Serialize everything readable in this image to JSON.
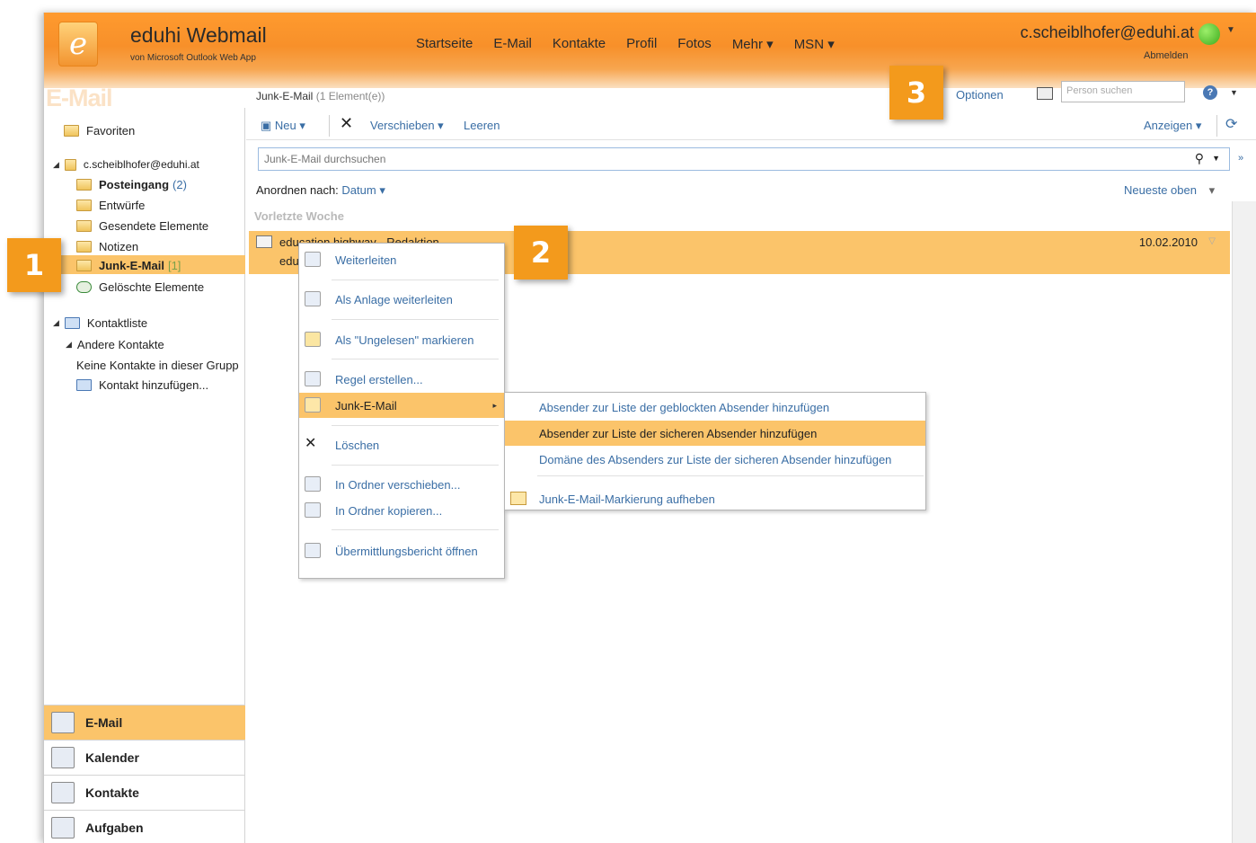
{
  "app": {
    "title": "eduhi Webmail",
    "subtitle": "von Microsoft Outlook Web App",
    "logo_letter": "e",
    "user": "c.scheiblhofer@eduhi.at",
    "signout": "Abmelden"
  },
  "topnav": [
    "Startseite",
    "E-Mail",
    "Kontakte",
    "Profil",
    "Fotos",
    "Mehr ▾",
    "MSN ▾"
  ],
  "section_title": "E-Mail",
  "folder_path": {
    "name": "Junk-E-Mail",
    "count": "(1 Element(e))"
  },
  "top_right": {
    "options": "Optionen",
    "person_search_placeholder": "Person suchen"
  },
  "sidebar": {
    "favorites": "Favoriten",
    "account": "c.scheiblhofer@eduhi.at",
    "folders": [
      {
        "label": "Posteingang",
        "count": "(2)",
        "bold": true
      },
      {
        "label": "Entwürfe",
        "count": ""
      },
      {
        "label": "Gesendete Elemente",
        "count": ""
      },
      {
        "label": "Notizen",
        "count": ""
      },
      {
        "label": "Junk-E-Mail",
        "count": "[1]",
        "bold": true,
        "selected": true
      },
      {
        "label": "Gelöschte Elemente",
        "count": ""
      }
    ],
    "contacts_header": "Kontaktliste",
    "other_contacts": "Andere Kontakte",
    "no_contacts": "Keine Kontakte in dieser Grupp",
    "add_contact": "Kontakt hinzufügen...",
    "grip": "..........",
    "bottom_nav": [
      "E-Mail",
      "Kalender",
      "Kontakte",
      "Aufgaben"
    ]
  },
  "toolbar": {
    "new": "Neu",
    "move": "Verschieben",
    "empty": "Leeren",
    "view": "Anzeigen"
  },
  "search": {
    "placeholder": "Junk-E-Mail durchsuchen"
  },
  "sort": {
    "label": "Anordnen nach:",
    "field": "Datum",
    "order": "Neueste oben"
  },
  "group_header": "Vorletzte Woche",
  "message": {
    "from": "education highway - Redaktion",
    "subject": "edu",
    "date": "10.02.2010"
  },
  "context_menu": [
    "Weiterleiten",
    "Als Anlage weiterleiten",
    "Als \"Ungelesen\" markieren",
    "Regel erstellen...",
    "Junk-E-Mail",
    "Löschen",
    "In Ordner verschieben...",
    "In Ordner kopieren...",
    "Übermittlungsbericht öffnen"
  ],
  "submenu": [
    "Absender zur Liste der geblockten Absender hinzufügen",
    "Absender zur Liste der sicheren Absender hinzufügen",
    "Domäne des Absenders zur Liste der sicheren Absender hinzufügen",
    "Junk-E-Mail-Markierung aufheben"
  ],
  "callouts": [
    "1",
    "2",
    "3"
  ],
  "colors": {
    "header_orange": "#f7902a",
    "highlight": "#fbc46a",
    "link": "#3a6ea5",
    "callout": "#f39a1c"
  }
}
